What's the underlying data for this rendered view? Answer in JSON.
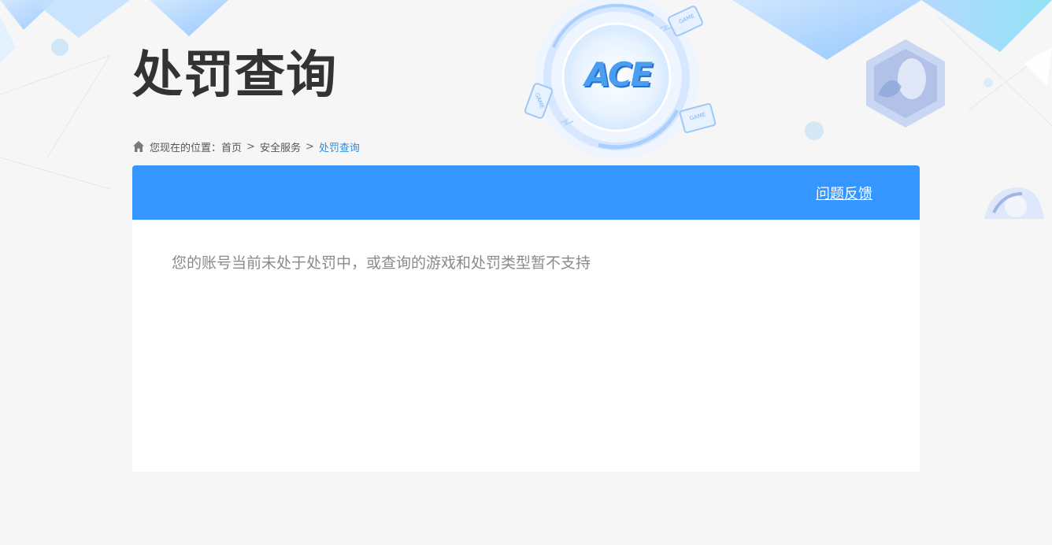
{
  "header": {
    "title": "处罚查询",
    "logo_text": "ACE",
    "device_label": "GAME"
  },
  "breadcrumb": {
    "prefix": "您现在的位置：",
    "items": [
      "首页",
      "安全服务",
      "处罚查询"
    ],
    "separator": ">"
  },
  "panel": {
    "feedback_label": "问题反馈",
    "message": "您的账号当前未处于处罚中，或查询的游戏和处罚类型暂不支持"
  },
  "colors": {
    "accent": "#3596ff",
    "breadcrumb_current": "#2a8de0",
    "title": "#333333",
    "background": "#f6f6f7"
  }
}
